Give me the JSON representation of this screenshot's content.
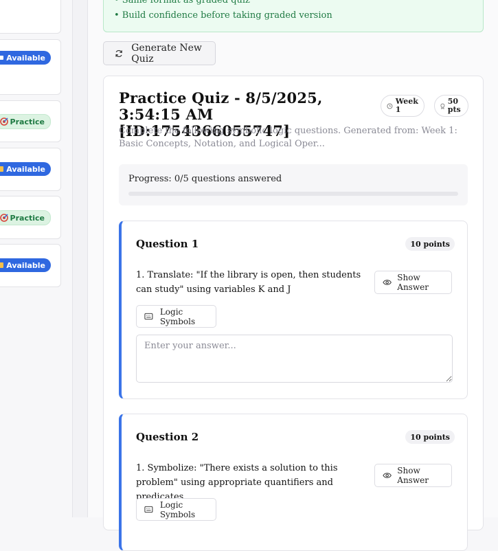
{
  "sidebar": {
    "cards": [
      {
        "badge": "",
        "type": "available",
        "icon": "book-icon"
      },
      {
        "badge": "Available",
        "type": "available",
        "icon": "book-icon"
      },
      {
        "badge": "Practice",
        "type": "practice",
        "icon": "target-icon"
      },
      {
        "badge": "Available",
        "type": "available",
        "icon": "book-icon"
      },
      {
        "badge": "Practice",
        "type": "practice",
        "icon": "target-icon"
      },
      {
        "badge": "Available",
        "type": "available",
        "icon": "book-icon"
      }
    ]
  },
  "info": {
    "lines": [
      "• Same format as graded quiz",
      "• Build confidence before taking graded version"
    ]
  },
  "generate_button": {
    "label": "Generate New Quiz",
    "icon": "refresh-icon"
  },
  "quiz": {
    "title": "Practice Quiz - 8/5/2025, 3:54:15 AM [ID:1754366055747]",
    "week_badge": "Week 1",
    "points_badge": "50 pts",
    "description": "Complete the following symbolic logic questions. Generated from: Week 1: Basic Concepts, Notation, and Logical Oper...",
    "progress": {
      "label": "Progress: 0/5 questions answered",
      "answered": 0,
      "total": 5
    },
    "questions": [
      {
        "title": "Question 1",
        "points": "10 points",
        "text": "1. Translate: \"If the library is open, then students can study\" using variables K and J",
        "show_answer": "Show Answer",
        "logic_symbols": "Logic Symbols",
        "placeholder": "Enter your answer..."
      },
      {
        "title": "Question 2",
        "points": "10 points",
        "text": "1. Symbolize: \"There exists a solution to this problem\" using appropriate quantifiers and predicates",
        "show_answer": "Show Answer",
        "logic_symbols": "Logic Symbols"
      }
    ]
  },
  "colors": {
    "accent": "#2f68e0",
    "practice_bg": "#dcf3e2",
    "practice_text": "#1f7a43",
    "question_border": "#3b74e8"
  }
}
